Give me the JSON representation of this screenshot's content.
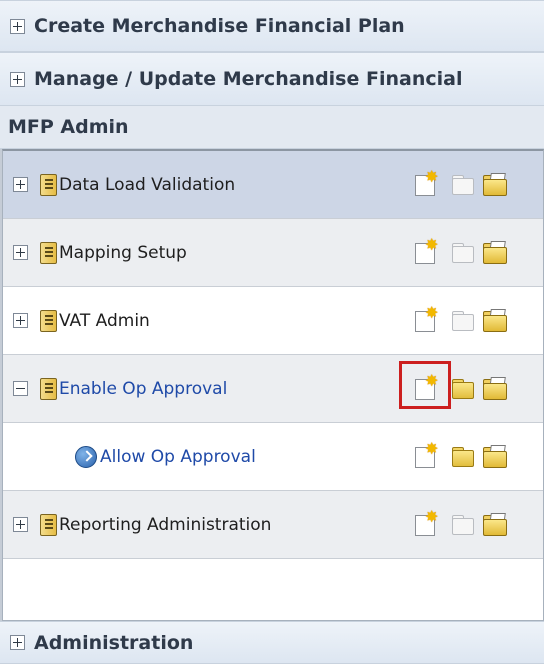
{
  "accordion": {
    "create_plan": "Create Merchandise Financial Plan",
    "manage_plan": "Manage / Update Merchandise Financial",
    "administration": "Administration"
  },
  "section": {
    "title": "MFP Admin"
  },
  "tasks": [
    {
      "label": "Data Load Validation",
      "expander": "plus",
      "icon": "task-document-icon",
      "open_enabled": false,
      "selected": true
    },
    {
      "label": "Mapping Setup",
      "expander": "plus",
      "icon": "task-document-icon",
      "open_enabled": false
    },
    {
      "label": "VAT Admin",
      "expander": "plus",
      "icon": "task-document-icon",
      "open_enabled": false
    },
    {
      "label": "Enable Op Approval",
      "expander": "minus",
      "icon": "task-document-icon",
      "open_enabled": true,
      "link": true
    },
    {
      "label": "Allow Op Approval",
      "expander": "none",
      "icon": "arrow-circle-icon",
      "open_enabled": true,
      "link": true,
      "indent": true
    },
    {
      "label": "Reporting Administration",
      "expander": "plus",
      "icon": "task-document-icon",
      "open_enabled": false
    }
  ],
  "actions": {
    "new": "new-workbook-icon",
    "open": "open-workbook-icon",
    "browse": "browse-folder-icon"
  },
  "colors": {
    "highlight": "#cc1f1f",
    "link": "#1f4aa8",
    "selected_row": "#cdd6e6"
  }
}
